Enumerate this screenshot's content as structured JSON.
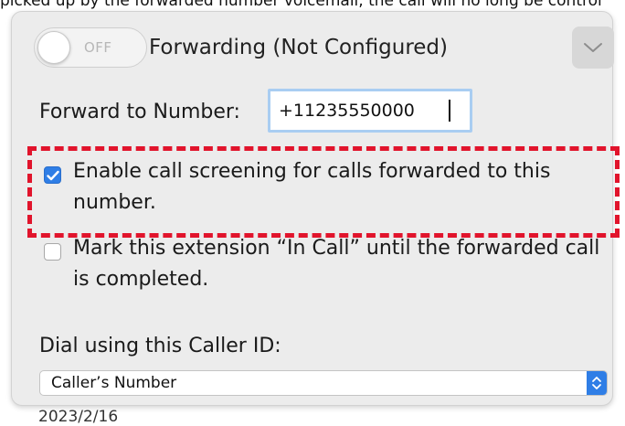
{
  "background_text": {
    "top": "picked up by the forwarded number voicemail, the call will no long be control",
    "bottom": "2023/2/16"
  },
  "forwarding": {
    "toggle_state": "OFF",
    "title": "Forwarding (Not Configured)",
    "expand_icon": "chevron-down-icon",
    "number_label": "Forward to Number:",
    "number_value": "+11235550000",
    "options": [
      {
        "label": "Enable call screening for calls forwarded to this number.",
        "checked": true,
        "highlighted": true
      },
      {
        "label": "Mark this extension “In Call” until the forwarded call is completed.",
        "checked": false,
        "highlighted": false
      }
    ],
    "caller_id_label": "Dial using this Caller ID:",
    "caller_id_selected": "Caller’s Number"
  },
  "colors": {
    "accent": "#2f7ee6",
    "highlight_dash": "#e1142c",
    "panel_bg": "#ececec"
  }
}
